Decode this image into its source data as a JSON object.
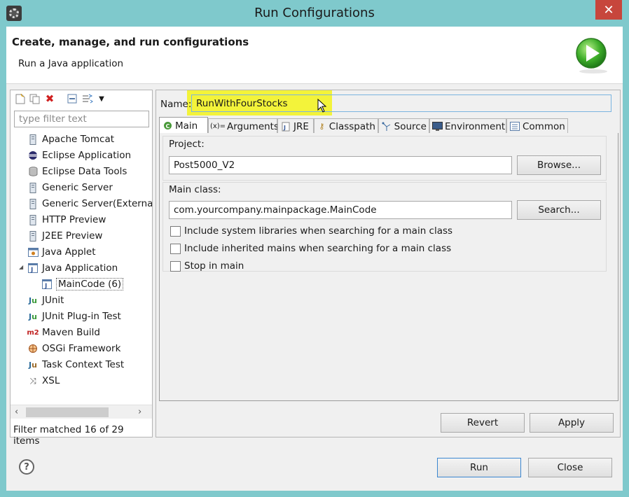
{
  "window": {
    "title": "Run Configurations"
  },
  "banner": {
    "title": "Create, manage, and run configurations",
    "subtitle": "Run a Java application"
  },
  "left": {
    "filter_placeholder": "type filter text",
    "items": [
      {
        "label": "Apache Tomcat",
        "icon": "server-icon"
      },
      {
        "label": "Eclipse Application",
        "icon": "eclipse-icon"
      },
      {
        "label": "Eclipse Data Tools",
        "icon": "database-icon"
      },
      {
        "label": "Generic Server",
        "icon": "server-icon"
      },
      {
        "label": "Generic Server(Externa",
        "icon": "server-icon"
      },
      {
        "label": "HTTP Preview",
        "icon": "server-icon"
      },
      {
        "label": "J2EE Preview",
        "icon": "server-icon"
      },
      {
        "label": "Java Applet",
        "icon": "applet-icon"
      },
      {
        "label": "Java Application",
        "icon": "java-app-icon"
      },
      {
        "label": "MainCode (6)",
        "icon": "java-app-icon"
      },
      {
        "label": "JUnit",
        "icon": "junit-icon"
      },
      {
        "label": "JUnit Plug-in Test",
        "icon": "junit-plugin-icon"
      },
      {
        "label": "Maven Build",
        "icon": "maven-icon"
      },
      {
        "label": "OSGi Framework",
        "icon": "osgi-icon"
      },
      {
        "label": "Task Context Test",
        "icon": "task-context-icon"
      },
      {
        "label": "XSL",
        "icon": "xsl-icon"
      }
    ],
    "status": "Filter matched 16 of 29 items"
  },
  "right": {
    "name_label": "Name:",
    "name_value": "RunWithFourStocks",
    "tabs": [
      {
        "label": "Main",
        "icon": "main-tab-icon"
      },
      {
        "label": "Arguments",
        "icon": "arguments-icon"
      },
      {
        "label": "JRE",
        "icon": "jre-icon"
      },
      {
        "label": "Classpath",
        "icon": "classpath-icon"
      },
      {
        "label": "Source",
        "icon": "source-icon"
      },
      {
        "label": "Environment",
        "icon": "environment-icon"
      },
      {
        "label": "Common",
        "icon": "common-icon"
      }
    ],
    "project_label": "Project:",
    "project_value": "Post5000_V2",
    "browse_label": "Browse...",
    "mainclass_label": "Main class:",
    "mainclass_value": "com.yourcompany.mainpackage.MainCode",
    "search_label": "Search...",
    "checkboxes": [
      "Include system libraries when searching for a main class",
      "Include inherited mains when searching for a main class",
      "Stop in main"
    ],
    "revert_label": "Revert",
    "apply_label": "Apply"
  },
  "footer": {
    "run_label": "Run",
    "close_label": "Close"
  }
}
